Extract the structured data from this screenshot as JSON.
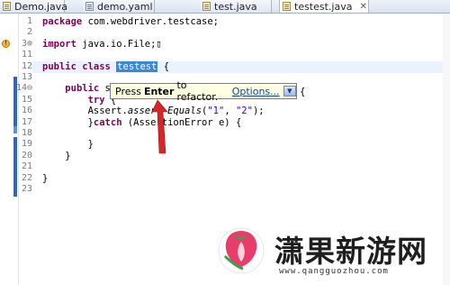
{
  "tabs": [
    {
      "label": "Demo.java",
      "type": "java"
    },
    {
      "label": "demo.yaml",
      "type": "yaml"
    },
    {
      "label": "test.java",
      "type": "java"
    },
    {
      "label": "testest.java",
      "type": "java",
      "close": "✕"
    }
  ],
  "editor": {
    "lines": [
      {
        "no": "1",
        "html": "<span class=\"kw\">package</span> com.webdriver.testcase;"
      },
      {
        "no": "2",
        "html": ""
      },
      {
        "no": "3⊕",
        "html": "<span class=\"kw\">import</span> java.io.File;▯"
      },
      {
        "no": "11",
        "html": ""
      },
      {
        "no": "12",
        "html": "<span class=\"kw\">public class</span> <span class=\"sel-ident\">testest</span> {"
      },
      {
        "no": "13",
        "html": ""
      },
      {
        "no": "14⊖",
        "html": "    <span class=\"kw\">public</span> s"
      },
      {
        "no": "15",
        "html": "        <span class=\"kw\">try</span> {"
      },
      {
        "no": "16",
        "html": "        Assert.<i>asser</i>  <i>Equals</i>(<span class=\"str\">\"1\"</span>, <span class=\"str\">\"2\"</span>);"
      },
      {
        "no": "17",
        "html": "        }<span class=\"kw\">catch</span> (AssertionError e) {"
      },
      {
        "no": "18",
        "html": ""
      },
      {
        "no": "19",
        "html": "        }"
      },
      {
        "no": "20",
        "html": "    }"
      },
      {
        "no": "21",
        "html": ""
      },
      {
        "no": "22",
        "html": "}"
      },
      {
        "no": "23",
        "html": ""
      }
    ],
    "method_tail": "{"
  },
  "tooltip": {
    "press": "Press",
    "key": "Enter",
    "rest": "to refactor.",
    "options_link": "Options...",
    "dropdown_glyph": "▼"
  },
  "watermark": {
    "brand": "潇果新游网",
    "url": "www.qangguozhou.com"
  },
  "colors": {
    "keyword": "#7f0055",
    "string": "#2a00ff",
    "selection": "#3a88d8",
    "tooltip_bg": "#ffffe1",
    "arrow": "#d4272b"
  }
}
